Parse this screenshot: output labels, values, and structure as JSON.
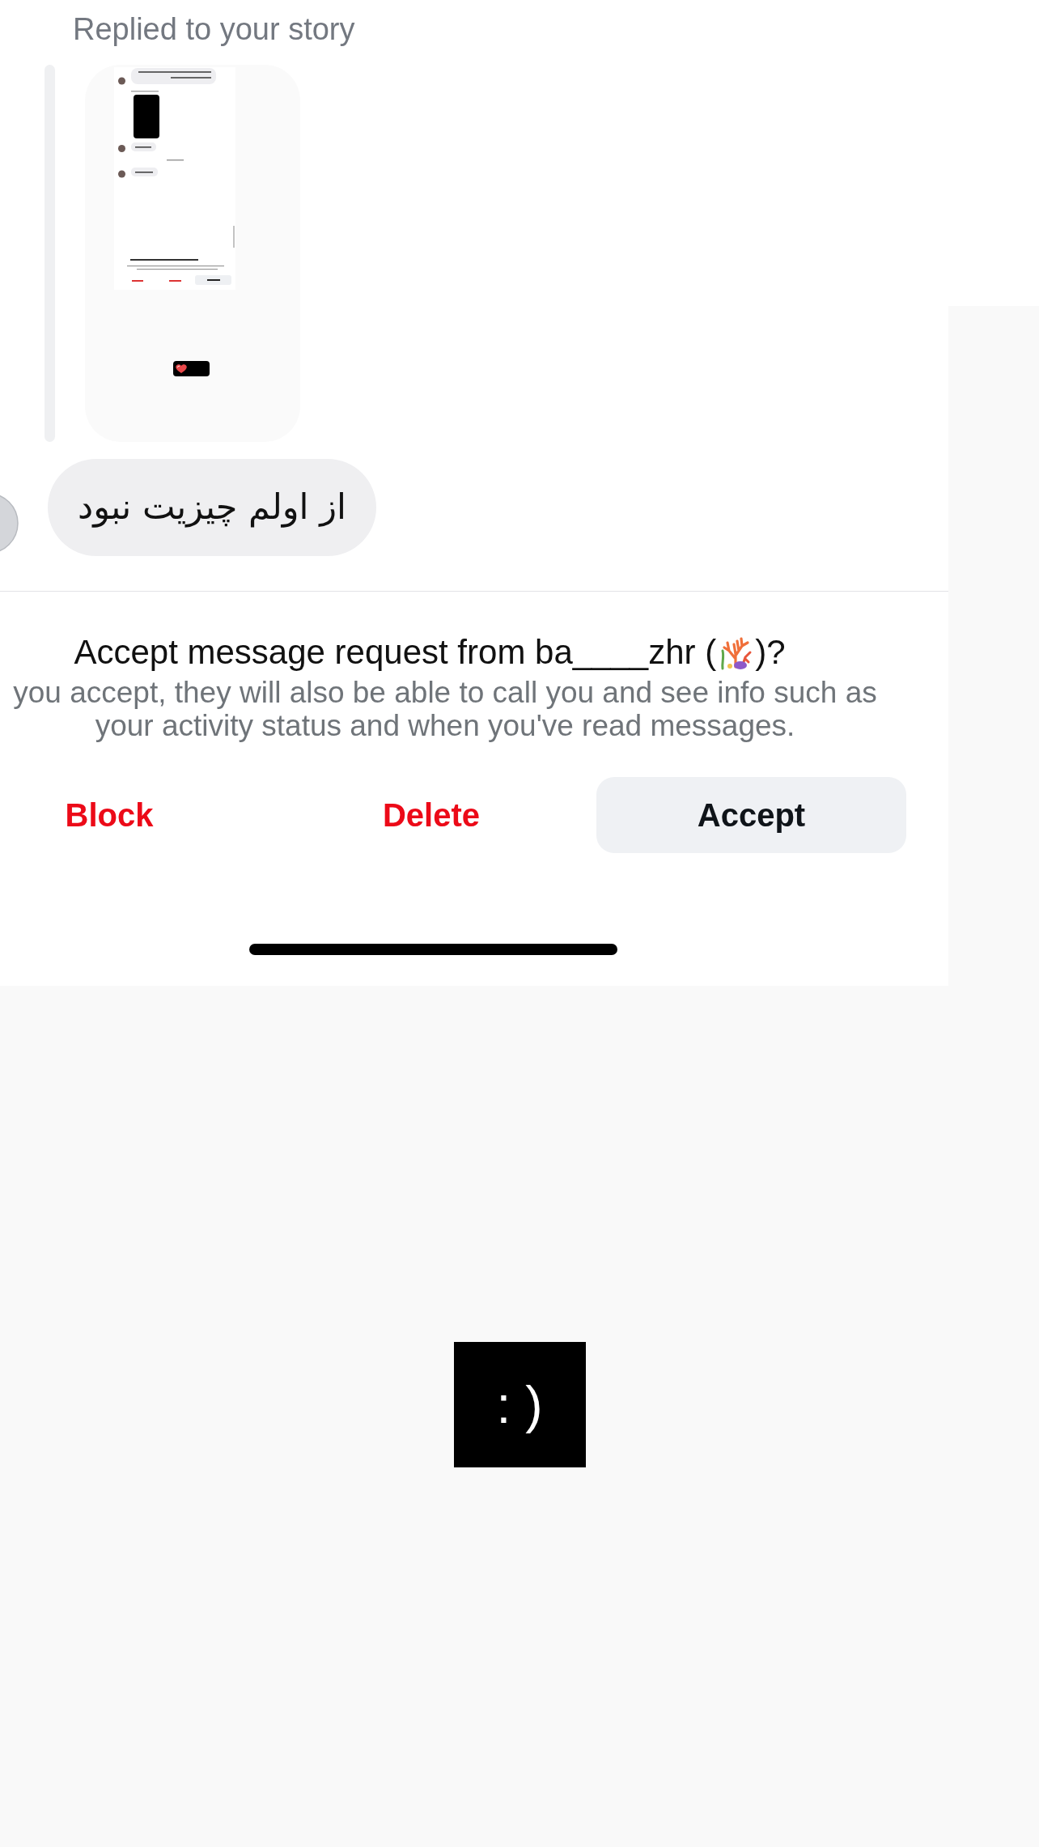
{
  "story_reply": {
    "label": "Replied to your story"
  },
  "message": {
    "text": "از اولم چیزیت نبود"
  },
  "request": {
    "title_start": "Accept message request from ba____zhr (",
    "title_end": ")?",
    "body": "you accept, they will also be able to call you and see info such as your activity status and when you've read messages.",
    "actions": [
      {
        "label": "Block",
        "kind": "destructive"
      },
      {
        "label": "Delete",
        "kind": "destructive"
      },
      {
        "label": "Accept",
        "kind": "filled"
      }
    ]
  },
  "emoticon": ": )"
}
